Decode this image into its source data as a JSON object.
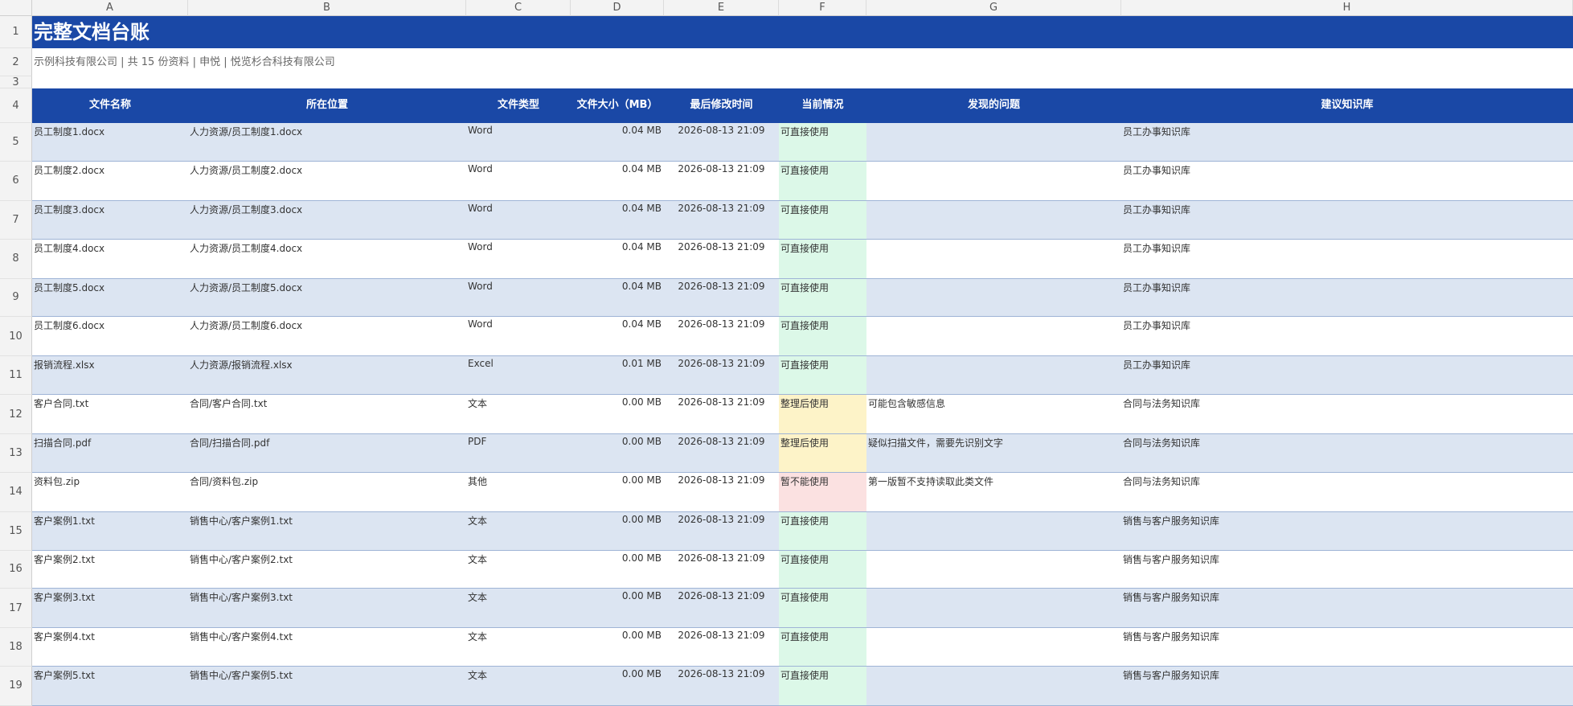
{
  "columns": [
    "A",
    "B",
    "C",
    "D",
    "E",
    "F",
    "G",
    "H"
  ],
  "row_numbers": [
    "1",
    "2",
    "3",
    "4",
    "5",
    "6",
    "7",
    "8",
    "9",
    "10",
    "11",
    "12",
    "13",
    "14",
    "15",
    "16",
    "17",
    "18",
    "19"
  ],
  "title": "完整文档台账",
  "subtitle": "示例科技有限公司 | 共 15 份资料 | 申悦 | 悦览杉合科技有限公司",
  "headers": [
    "文件名称",
    "所在位置",
    "文件类型",
    "文件大小（MB）",
    "最后修改时间",
    "当前情况",
    "发现的问题",
    "建议知识库"
  ],
  "colors": {
    "title_bg": "#1a48a6",
    "band": "#dce5f2",
    "white": "#ffffff",
    "status_ok": "#dcf8e8",
    "status_fix": "#fdf3c8",
    "status_bad": "#fbe1e1"
  },
  "rows": [
    {
      "name": "员工制度1.docx",
      "path": "人力资源/员工制度1.docx",
      "type": "Word",
      "size": "0.04 MB",
      "mtime": "2026-08-13 21:09",
      "status": "可直接使用",
      "status_kind": "ok",
      "issue": "",
      "kb": "员工办事知识库"
    },
    {
      "name": "员工制度2.docx",
      "path": "人力资源/员工制度2.docx",
      "type": "Word",
      "size": "0.04 MB",
      "mtime": "2026-08-13 21:09",
      "status": "可直接使用",
      "status_kind": "ok",
      "issue": "",
      "kb": "员工办事知识库"
    },
    {
      "name": "员工制度3.docx",
      "path": "人力资源/员工制度3.docx",
      "type": "Word",
      "size": "0.04 MB",
      "mtime": "2026-08-13 21:09",
      "status": "可直接使用",
      "status_kind": "ok",
      "issue": "",
      "kb": "员工办事知识库"
    },
    {
      "name": "员工制度4.docx",
      "path": "人力资源/员工制度4.docx",
      "type": "Word",
      "size": "0.04 MB",
      "mtime": "2026-08-13 21:09",
      "status": "可直接使用",
      "status_kind": "ok",
      "issue": "",
      "kb": "员工办事知识库"
    },
    {
      "name": "员工制度5.docx",
      "path": "人力资源/员工制度5.docx",
      "type": "Word",
      "size": "0.04 MB",
      "mtime": "2026-08-13 21:09",
      "status": "可直接使用",
      "status_kind": "ok",
      "issue": "",
      "kb": "员工办事知识库"
    },
    {
      "name": "员工制度6.docx",
      "path": "人力资源/员工制度6.docx",
      "type": "Word",
      "size": "0.04 MB",
      "mtime": "2026-08-13 21:09",
      "status": "可直接使用",
      "status_kind": "ok",
      "issue": "",
      "kb": "员工办事知识库"
    },
    {
      "name": "报销流程.xlsx",
      "path": "人力资源/报销流程.xlsx",
      "type": "Excel",
      "size": "0.01 MB",
      "mtime": "2026-08-13 21:09",
      "status": "可直接使用",
      "status_kind": "ok",
      "issue": "",
      "kb": "员工办事知识库"
    },
    {
      "name": "客户合同.txt",
      "path": "合同/客户合同.txt",
      "type": "文本",
      "size": "0.00 MB",
      "mtime": "2026-08-13 21:09",
      "status": "整理后使用",
      "status_kind": "fix",
      "issue": "可能包含敏感信息",
      "kb": "合同与法务知识库"
    },
    {
      "name": "扫描合同.pdf",
      "path": "合同/扫描合同.pdf",
      "type": "PDF",
      "size": "0.00 MB",
      "mtime": "2026-08-13 21:09",
      "status": "整理后使用",
      "status_kind": "fix",
      "issue": "疑似扫描文件，需要先识别文字",
      "kb": "合同与法务知识库"
    },
    {
      "name": "资料包.zip",
      "path": "合同/资料包.zip",
      "type": "其他",
      "size": "0.00 MB",
      "mtime": "2026-08-13 21:09",
      "status": "暂不能使用",
      "status_kind": "bad",
      "issue": "第一版暂不支持读取此类文件",
      "kb": "合同与法务知识库"
    },
    {
      "name": "客户案例1.txt",
      "path": "销售中心/客户案例1.txt",
      "type": "文本",
      "size": "0.00 MB",
      "mtime": "2026-08-13 21:09",
      "status": "可直接使用",
      "status_kind": "ok",
      "issue": "",
      "kb": "销售与客户服务知识库"
    },
    {
      "name": "客户案例2.txt",
      "path": "销售中心/客户案例2.txt",
      "type": "文本",
      "size": "0.00 MB",
      "mtime": "2026-08-13 21:09",
      "status": "可直接使用",
      "status_kind": "ok",
      "issue": "",
      "kb": "销售与客户服务知识库"
    },
    {
      "name": "客户案例3.txt",
      "path": "销售中心/客户案例3.txt",
      "type": "文本",
      "size": "0.00 MB",
      "mtime": "2026-08-13 21:09",
      "status": "可直接使用",
      "status_kind": "ok",
      "issue": "",
      "kb": "销售与客户服务知识库"
    },
    {
      "name": "客户案例4.txt",
      "path": "销售中心/客户案例4.txt",
      "type": "文本",
      "size": "0.00 MB",
      "mtime": "2026-08-13 21:09",
      "status": "可直接使用",
      "status_kind": "ok",
      "issue": "",
      "kb": "销售与客户服务知识库"
    },
    {
      "name": "客户案例5.txt",
      "path": "销售中心/客户案例5.txt",
      "type": "文本",
      "size": "0.00 MB",
      "mtime": "2026-08-13 21:09",
      "status": "可直接使用",
      "status_kind": "ok",
      "issue": "",
      "kb": "销售与客户服务知识库"
    }
  ]
}
